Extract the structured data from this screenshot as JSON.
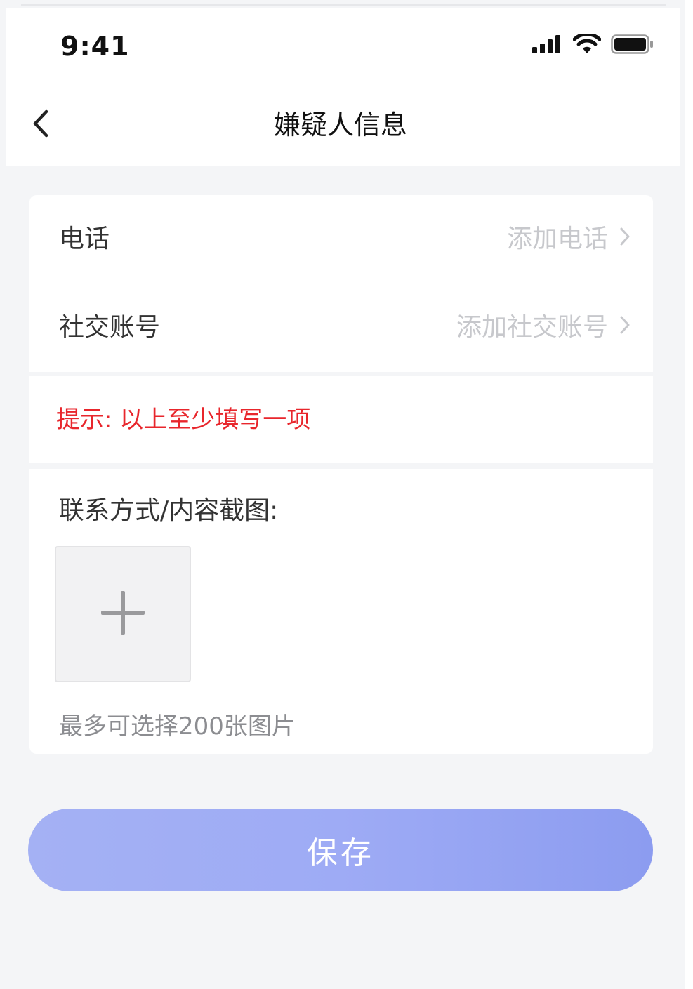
{
  "status_bar": {
    "time": "9:41"
  },
  "nav": {
    "title": "嫌疑人信息",
    "back_icon": "chevron-left-icon"
  },
  "form": {
    "phone": {
      "label": "电话",
      "placeholder": "添加电话"
    },
    "social": {
      "label": "社交账号",
      "placeholder": "添加社交账号"
    },
    "hint": "提示: 以上至少填写一项",
    "upload": {
      "title": "联系方式/内容截图:",
      "add_icon": "plus-icon",
      "limit_text": "最多可选择200张图片"
    }
  },
  "actions": {
    "save_label": "保存"
  },
  "colors": {
    "hint_red": "#e8262c",
    "save_button": "#9eabf5",
    "placeholder_gray": "#c7c8cc"
  }
}
